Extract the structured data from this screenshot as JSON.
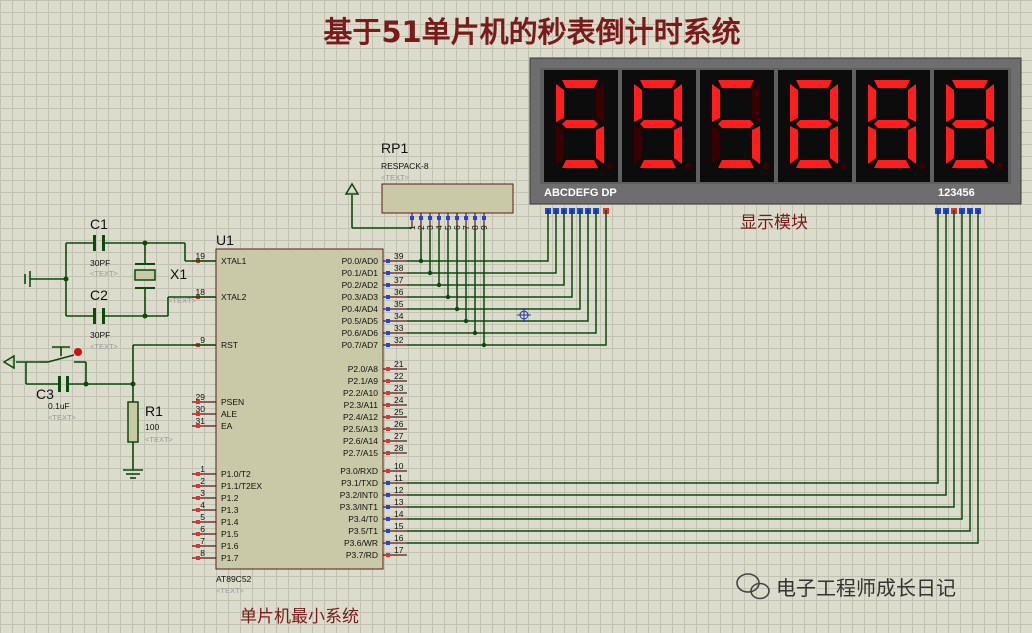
{
  "title": "基于51单片机的秒表倒计时系统",
  "mcu": {
    "ref": "U1",
    "part": "AT89C52",
    "text_placeholder": "<TEXT>",
    "left_pins": [
      {
        "num": "19",
        "name": "XTAL1"
      },
      {
        "num": "18",
        "name": "XTAL2"
      },
      {
        "num": "9",
        "name": "RST"
      },
      {
        "num": "29",
        "name": "PSEN"
      },
      {
        "num": "30",
        "name": "ALE"
      },
      {
        "num": "31",
        "name": "EA"
      },
      {
        "num": "1",
        "name": "P1.0/T2"
      },
      {
        "num": "2",
        "name": "P1.1/T2EX"
      },
      {
        "num": "3",
        "name": "P1.2"
      },
      {
        "num": "4",
        "name": "P1.3"
      },
      {
        "num": "5",
        "name": "P1.4"
      },
      {
        "num": "6",
        "name": "P1.5"
      },
      {
        "num": "7",
        "name": "P1.6"
      },
      {
        "num": "8",
        "name": "P1.7"
      }
    ],
    "right_pins": [
      {
        "num": "39",
        "name": "P0.0/AD0"
      },
      {
        "num": "38",
        "name": "P0.1/AD1"
      },
      {
        "num": "37",
        "name": "P0.2/AD2"
      },
      {
        "num": "36",
        "name": "P0.3/AD3"
      },
      {
        "num": "35",
        "name": "P0.4/AD4"
      },
      {
        "num": "34",
        "name": "P0.5/AD5"
      },
      {
        "num": "33",
        "name": "P0.6/AD6"
      },
      {
        "num": "32",
        "name": "P0.7/AD7"
      },
      {
        "num": "21",
        "name": "P2.0/A8"
      },
      {
        "num": "22",
        "name": "P2.1/A9"
      },
      {
        "num": "23",
        "name": "P2.2/A10"
      },
      {
        "num": "24",
        "name": "P2.3/A11"
      },
      {
        "num": "25",
        "name": "P2.4/A12"
      },
      {
        "num": "26",
        "name": "P2.5/A13"
      },
      {
        "num": "27",
        "name": "P2.6/A14"
      },
      {
        "num": "28",
        "name": "P2.7/A15"
      },
      {
        "num": "10",
        "name": "P3.0/RXD"
      },
      {
        "num": "11",
        "name": "P3.1/TXD"
      },
      {
        "num": "12",
        "name": "P3.2/INT0"
      },
      {
        "num": "13",
        "name": "P3.3/INT1"
      },
      {
        "num": "14",
        "name": "P3.4/T0"
      },
      {
        "num": "15",
        "name": "P3.5/T1"
      },
      {
        "num": "16",
        "name": "P3.6/WR"
      },
      {
        "num": "17",
        "name": "P3.7/RD"
      }
    ]
  },
  "rp1": {
    "ref": "RP1",
    "part": "RESPACK-8",
    "text": "<TEXT>",
    "pins": [
      "1",
      "2",
      "3",
      "4",
      "5",
      "6",
      "7",
      "8",
      "9"
    ]
  },
  "c1": {
    "ref": "C1",
    "value": "30PF",
    "text": "<TEXT>"
  },
  "c2": {
    "ref": "C2",
    "value": "30PF",
    "text": "<TEXT>"
  },
  "c3": {
    "ref": "C3",
    "value": "0.1uF",
    "text": "<TEXT>"
  },
  "x1": {
    "ref": "X1",
    "text": "<TEXT>"
  },
  "r1": {
    "ref": "R1",
    "value": "100",
    "text": "<TEXT>"
  },
  "display": {
    "digits": [
      "5",
      "9",
      "5",
      "8",
      "8",
      "8"
    ],
    "seg_label": "ABCDEFG DP",
    "digit_label": "123456",
    "caption": "显示模块"
  },
  "min_system_caption": "单片机最小系统",
  "watermark": "电子工程师成长日记",
  "colors": {
    "wire": "#0b4a0b",
    "segment_on": "#ff1e1e",
    "segment_off": "#3a0000",
    "title": "#7a1b1b"
  }
}
